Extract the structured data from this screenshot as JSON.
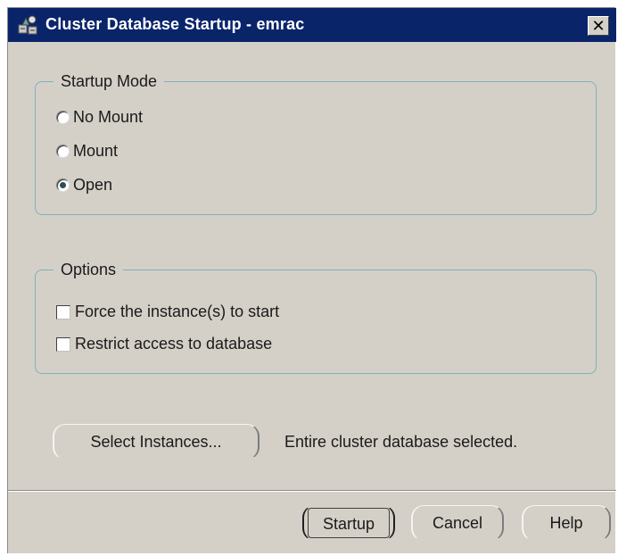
{
  "window": {
    "title": "Cluster Database Startup - emrac",
    "icon": "cluster-database-icon",
    "close_glyph": "✕"
  },
  "startup_mode": {
    "label": "Startup Mode",
    "options": [
      {
        "label": "No Mount",
        "checked": false
      },
      {
        "label": "Mount",
        "checked": false
      },
      {
        "label": "Open",
        "checked": true
      }
    ]
  },
  "options": {
    "label": "Options",
    "items": [
      {
        "label": "Force the instance(s) to start",
        "checked": false
      },
      {
        "label": "Restrict access to database",
        "checked": false
      }
    ]
  },
  "instances": {
    "button_label": "Select  Instances...",
    "status_text": "Entire cluster database selected."
  },
  "footer": {
    "startup_label": "Startup",
    "cancel_label": "Cancel",
    "help_label": "Help"
  },
  "colors": {
    "titlebar": "#0a246a",
    "dialog_bg": "#d4d0c8",
    "group_border": "#7fb0b8"
  }
}
